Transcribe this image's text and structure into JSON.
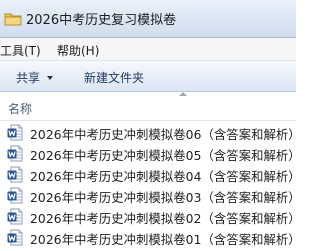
{
  "window": {
    "title": "2026中考历史复习模拟卷"
  },
  "menu": {
    "items": [
      "工具(T)",
      "帮助(H)"
    ]
  },
  "toolbar": {
    "share_label": "共享",
    "new_folder_label": "新建文件夹"
  },
  "list": {
    "column_name": "名称",
    "files": [
      "2026年中考历史冲刺模拟卷06（含答案和解析）",
      "2026年中考历史冲刺模拟卷05（含答案和解析）",
      "2026年中考历史冲刺模拟卷04（含答案和解析）",
      "2026年中考历史冲刺模拟卷03（含答案和解析）",
      "2026年中考历史冲刺模拟卷02（含答案和解析）",
      "2026年中考历史冲刺模拟卷01（含答案和解析）"
    ]
  },
  "colors": {
    "word_icon_blue": "#2b5797",
    "folder_yellow": "#e8c25a"
  },
  "icons": {
    "folder": "folder-icon",
    "document": "word-document-icon"
  }
}
